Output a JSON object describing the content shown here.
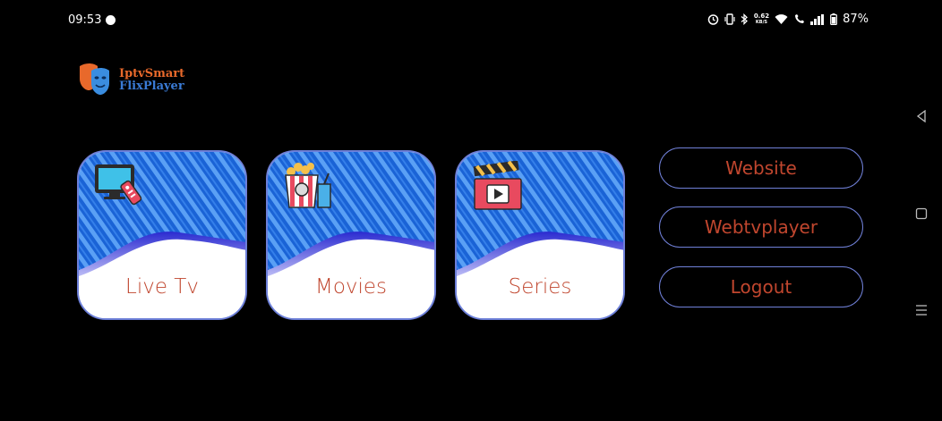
{
  "status": {
    "time": "09:53",
    "net_speed_value": "0.62",
    "net_speed_unit": "KB/S",
    "battery": "87%"
  },
  "logo": {
    "line1": "IptvSmart",
    "line2": "FlixPlayer"
  },
  "tiles": [
    {
      "label": "Live Tv",
      "icon": "tv-remote-icon"
    },
    {
      "label": "Movies",
      "icon": "popcorn-icon"
    },
    {
      "label": "Series",
      "icon": "clapperboard-icon"
    }
  ],
  "buttons": [
    {
      "label": "Website"
    },
    {
      "label": "Webtvplayer"
    },
    {
      "label": "Logout"
    }
  ],
  "colors": {
    "background": "#000000",
    "accent_text": "#c0462e",
    "border": "#7080d8",
    "tile_blue": "#1f6fe0"
  },
  "nav": {
    "icons": [
      "back-icon",
      "home-icon",
      "recents-icon"
    ]
  }
}
